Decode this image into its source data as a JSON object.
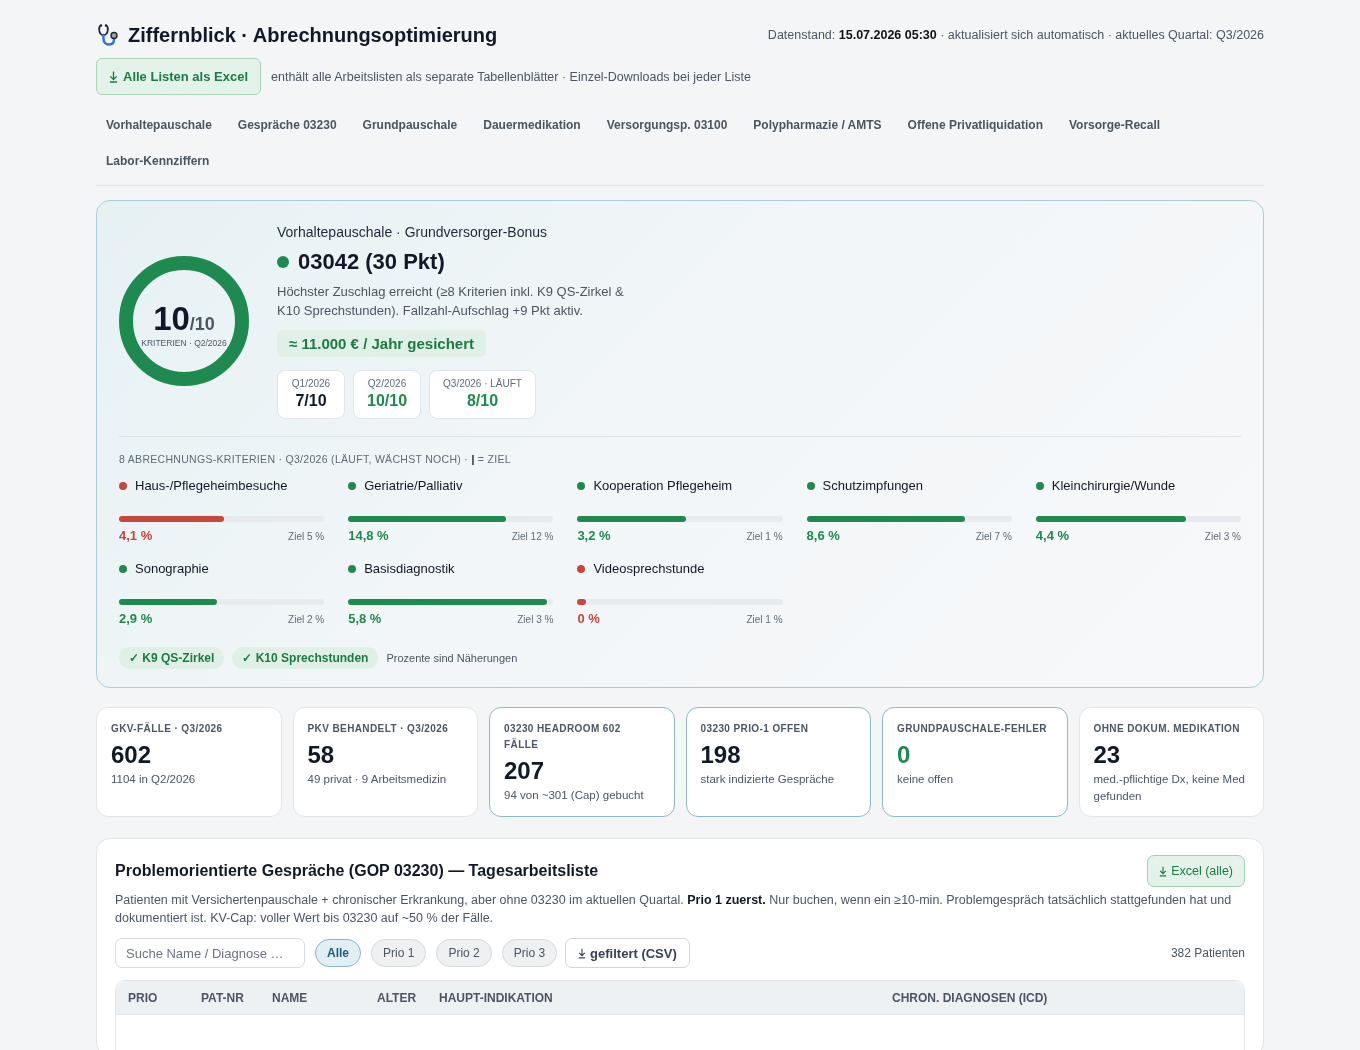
{
  "header": {
    "title": "Ziffernblick · Abrechnungsoptimierung",
    "meta": "Datenstand: **15.07.2026 05:30** · aktualisiert sich automatisch · aktuelles Quartal: Q3/2026",
    "export_button": "Alle Listen als Excel",
    "export_note": "enthält alle Arbeitslisten als separate Tabellenblätter · Einzel-Downloads bei jeder Liste"
  },
  "tabs": [
    {
      "label": "Vorhaltepauschale",
      "selected": false
    },
    {
      "label": "Gespräche 03230",
      "selected": false
    },
    {
      "label": "Grundpauschale",
      "selected": false
    },
    {
      "label": "Dauermedikation",
      "selected": false
    },
    {
      "label": "Versorgungsp. 03100",
      "selected": false
    },
    {
      "label": "Polypharmazie / AMTS",
      "selected": false
    },
    {
      "label": "Offene Privatliquidation",
      "selected": false
    },
    {
      "label": "Vorsorge-Recall",
      "selected": false
    },
    {
      "label": "Labor-Kennziffern",
      "selected": false
    }
  ],
  "hero": {
    "score": {
      "value": "10",
      "total": "/10",
      "label": "KRITERIEN · Q2/2026",
      "level": 1
    },
    "eyebrow": "Vorhaltepauschale · Grundversorger-Bonus",
    "code": "03042 (30 Pkt)",
    "description": "Höchster Zuschlag erreicht (≥8 Kriterien inkl. K9 QS-Zirkel & K10 Sprechstunden). Fallzahl-Aufschlag +9 Pkt aktiv.",
    "badge": "≈ 11.000 € / Jahr gesichert",
    "quarters": [
      {
        "label": "Q1/2026",
        "value": "7/10",
        "met": false
      },
      {
        "label": "Q2/2026",
        "value": "10/10",
        "met": true
      },
      {
        "label": "Q3/2026 · LÄUFT",
        "value": "8/10",
        "met": true
      }
    ]
  },
  "criteria": {
    "heading": "8 ABRECHNUNGS-KRITERIEN · Q3/2026 (LÄUFT, WÄCHST NOCH) · **|**  = ZIEL",
    "items": [
      {
        "name": "Haus-/Pflegeheimbesuche",
        "met": false,
        "level": 0.51,
        "value": "4,1 %",
        "target": "Ziel 5 %"
      },
      {
        "name": "Geriatrie/Palliativ",
        "met": true,
        "level": 0.77,
        "value": "14,8 %",
        "target": "Ziel 12 %"
      },
      {
        "name": "Kooperation Pflegeheim",
        "met": true,
        "level": 0.53,
        "value": "3,2 %",
        "target": "Ziel 1 %"
      },
      {
        "name": "Schutzimpfungen",
        "met": true,
        "level": 0.77,
        "value": "8,6 %",
        "target": "Ziel 7 %"
      },
      {
        "name": "Kleinchirurgie/Wunde",
        "met": true,
        "level": 0.73,
        "value": "4,4 %",
        "target": "Ziel 3 %"
      },
      {
        "name": "Sonographie",
        "met": true,
        "level": 0.48,
        "value": "2,9 %",
        "target": "Ziel 2 %"
      },
      {
        "name": "Basisdiagnostik",
        "met": true,
        "level": 0.97,
        "value": "5,8 %",
        "target": "Ziel 3 %"
      },
      {
        "name": "Videosprechstunde",
        "met": false,
        "level": 0.04,
        "value": "0 %",
        "target": "Ziel 1 %"
      }
    ],
    "chips": [
      "✓ K9 QS-Zirkel",
      "✓ K10 Sprechstunden"
    ],
    "note": "Prozente sind Näherungen"
  },
  "stats": [
    {
      "label": "GKV-FÄLLE · Q3/2026",
      "value": "602",
      "note": "1104 in Q2/2026",
      "highlighted": false,
      "good": false
    },
    {
      "label": "PKV BEHANDELT · Q3/2026",
      "value": "58",
      "note": "49 privat · 9 Arbeitsmedizin",
      "highlighted": false,
      "good": false
    },
    {
      "label": "03230 HEADROOM 602 FÄLLE",
      "value": "207",
      "note": "94 von ~301 (Cap) gebucht",
      "highlighted": true,
      "good": false
    },
    {
      "label": "03230 PRIO-1 OFFEN",
      "value": "198",
      "note": "stark indizierte Gespräche",
      "highlighted": true,
      "good": false
    },
    {
      "label": "GRUNDPAUSCHALE-FEHLER",
      "value": "0",
      "note": "keine offen",
      "highlighted": true,
      "good": true
    },
    {
      "label": "OHNE DOKUM. MEDIKATION",
      "value": "23",
      "note": "med.-pflichtige Dx, keine Med gefunden",
      "highlighted": false,
      "good": false
    }
  ],
  "worklist": {
    "title": "Problemorientierte Gespräche (GOP 03230) — Tagesarbeitsliste",
    "export_button": "Excel (alle)",
    "description": "Patienten mit Versichertenpauschale + chronischer Erkrankung, aber ohne 03230 im aktuellen Quartal. **Prio 1 zuerst.** Nur buchen, wenn ein ≥10-min. Problemgespräch tatsächlich stattgefunden hat und dokumentiert ist. KV-Cap: voller Wert bis 03230 auf ~50 % der Fälle.",
    "search": {
      "placeholder": "Suche Name / Diagnose …"
    },
    "filters": [
      {
        "label": "Alle",
        "selected": true
      },
      {
        "label": "Prio 1",
        "selected": false
      },
      {
        "label": "Prio 2",
        "selected": false
      },
      {
        "label": "Prio 3",
        "selected": false
      }
    ],
    "csv_button": "gefiltert (CSV)",
    "count": "382 Patienten",
    "table": {
      "columns": [
        "PRIO",
        "PAT-NR",
        "NAME",
        "ALTER",
        "HAUPT-INDIKATION",
        "CHRON. DIAGNOSEN (ICD)"
      ]
    }
  }
}
